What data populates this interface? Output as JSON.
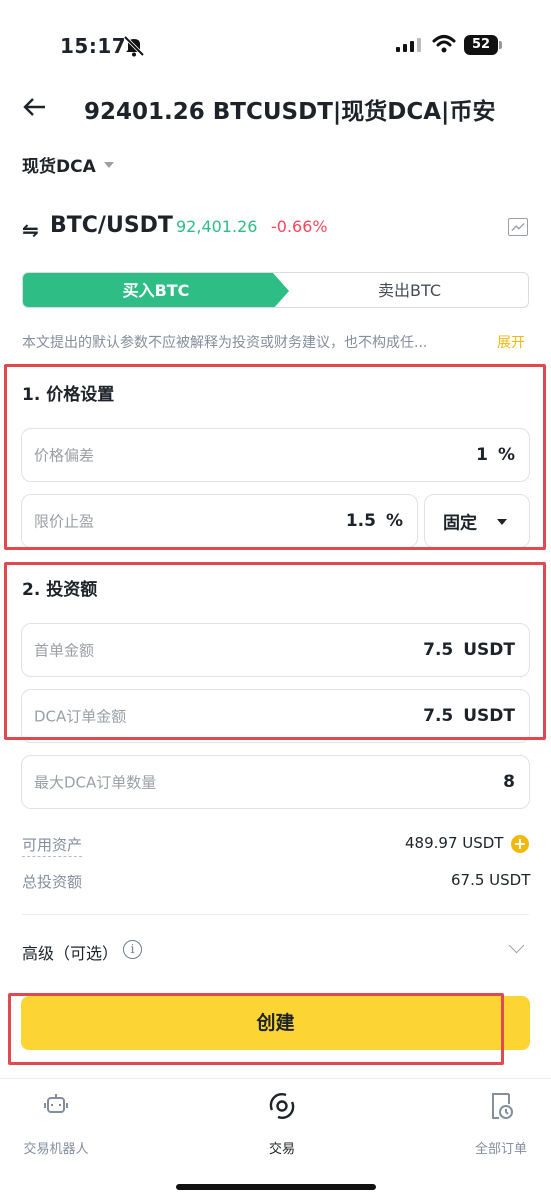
{
  "status_bar": {
    "time": "15:17",
    "battery": "52"
  },
  "header": {
    "title": "92401.26 BTCUSDT|现货DCA|币安"
  },
  "mode": {
    "label": "现货DCA"
  },
  "pair": {
    "symbol": "BTC/USDT",
    "price": "92,401.26",
    "change": "-0.66%"
  },
  "tabs": {
    "buy": "买入BTC",
    "sell": "卖出BTC"
  },
  "disclaimer": {
    "text": "本文提出的默认参数不应被解释为投资或财务建议，也不构成任...",
    "expand": "展开"
  },
  "price_settings": {
    "title": "1. 价格设置",
    "price_deviation": {
      "label": "价格偏差",
      "value": "1",
      "unit": "%"
    },
    "take_profit": {
      "label": "限价止盈",
      "value": "1.5",
      "unit": "%"
    },
    "mode_select": "固定"
  },
  "investment": {
    "title": "2. 投资额",
    "first_order": {
      "label": "首单金额",
      "value": "7.5",
      "unit": "USDT"
    },
    "dca_order": {
      "label": "DCA订单金额",
      "value": "7.5",
      "unit": "USDT"
    },
    "max_orders": {
      "label": "最大DCA订单数量",
      "value": "8"
    }
  },
  "summary": {
    "available_label": "可用资产",
    "available_value": "489.97 USDT",
    "total_label": "总投资额",
    "total_value": "67.5 USDT"
  },
  "advanced": {
    "label": "高级（可选）"
  },
  "create_button": "创建",
  "bottom_nav": [
    {
      "label": "交易机器人"
    },
    {
      "label": "交易"
    },
    {
      "label": "全部订单"
    }
  ],
  "colors": {
    "green": "#2ebd85",
    "red": "#f6465d",
    "yellow": "#fcd535",
    "highlight": "#e2494f"
  }
}
